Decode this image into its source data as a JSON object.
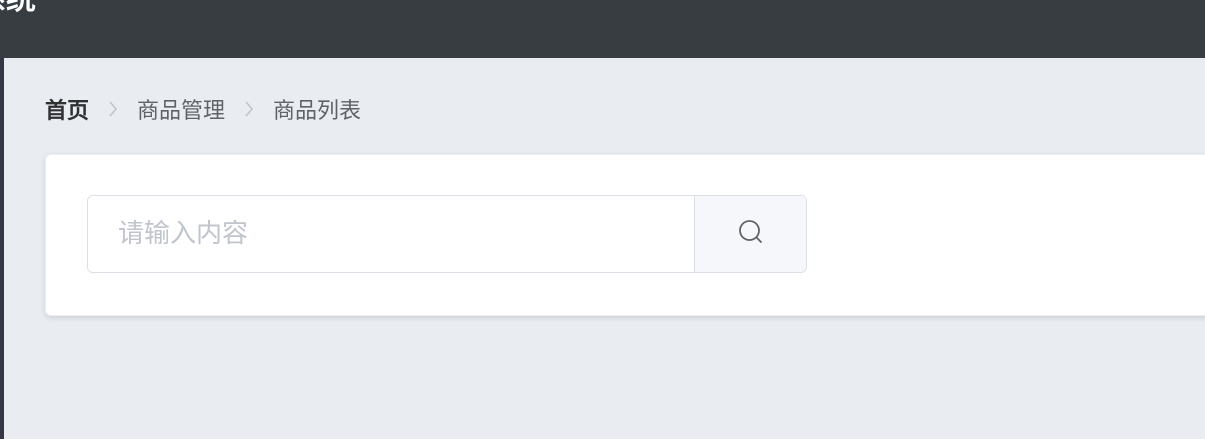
{
  "header": {
    "title": "系统"
  },
  "breadcrumb": {
    "items": [
      "首页",
      "商品管理",
      "商品列表"
    ]
  },
  "search": {
    "placeholder": "请输入内容",
    "value": ""
  },
  "icons": {
    "separator": "chevron-right-icon",
    "search_button": "search-icon"
  },
  "colors": {
    "header_bg": "#373d41",
    "page_bg": "#e9edf2",
    "card_bg": "#ffffff"
  }
}
